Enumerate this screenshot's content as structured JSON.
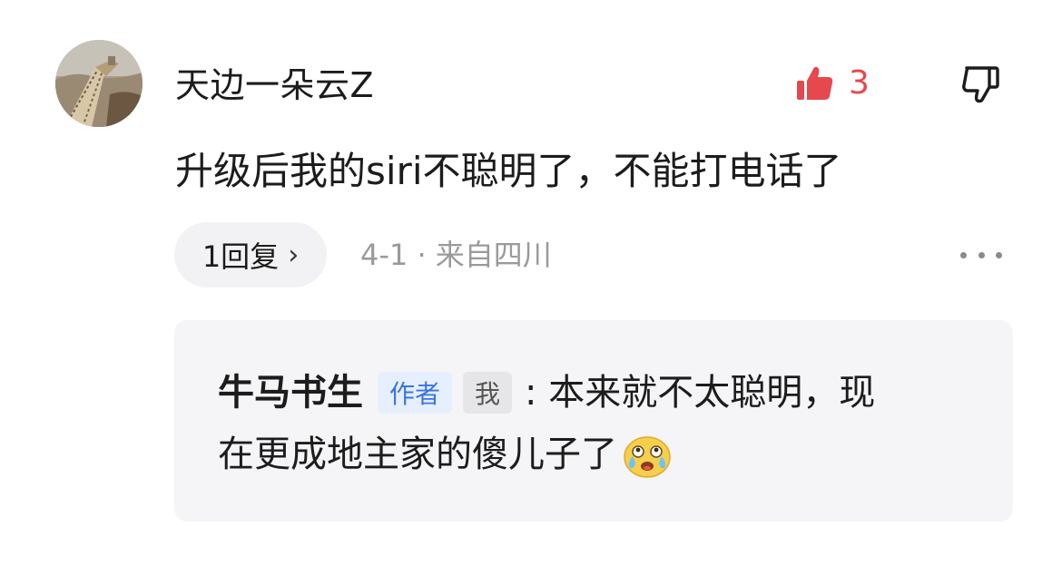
{
  "comment": {
    "username": "天边一朵云Z",
    "text": "升级后我的siri不聪明了，不能打电话了",
    "like_count": "3",
    "reply_label": "1回复",
    "meta": "4-1 · 来自四川",
    "icons": {
      "avatar": "great-wall-photo",
      "like": "thumbs-up-filled-icon",
      "dislike": "thumbs-down-outline-icon",
      "more": "more-dots-icon",
      "chevron": "chevron-right-icon"
    },
    "colors": {
      "like": "#e5484d",
      "author_badge": "#3b74e6"
    }
  },
  "reply": {
    "author": "牛马书生",
    "badge_author": "作者",
    "badge_me": "我",
    "text_line1": ": 本来就不太聪明，现",
    "text_line2": "在更成地主家的傻儿子了",
    "emoji": "crying-laughing-emoji"
  }
}
